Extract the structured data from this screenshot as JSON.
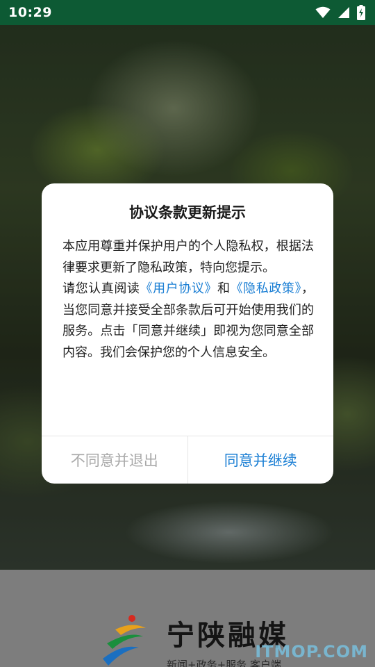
{
  "status_bar": {
    "time": "10:29",
    "icons": [
      "wifi-icon",
      "cellular-signal-icon",
      "battery-charging-icon"
    ]
  },
  "dialog": {
    "title": "协议条款更新提示",
    "paragraph1": "本应用尊重并保护用户的个人隐私权，根据法律要求更新了隐私政策，特向您提示。",
    "paragraph2_prefix": "请您认真阅读",
    "user_agreement_link": "《用户协议》",
    "and_text": "和",
    "privacy_policy_link": "《隐私政策》",
    "paragraph2_suffix": "，当您同意并接受全部条款后可开始使用我们的服务。点击「同意并继续」即视为您同意全部内容。我们会保护您的个人信息安全。",
    "disagree_button": "不同意并退出",
    "agree_button": "同意并继续"
  },
  "splash": {
    "brand_name": "宁陕融媒",
    "slogan": "新闻+政务+服务 客户端",
    "watermark": "ITMOP.COM"
  },
  "colors": {
    "status_bar": "#0d5a34",
    "link": "#1b7fd4",
    "disagree_text": "#a8a8a8",
    "dialog_bg": "#ffffff"
  }
}
